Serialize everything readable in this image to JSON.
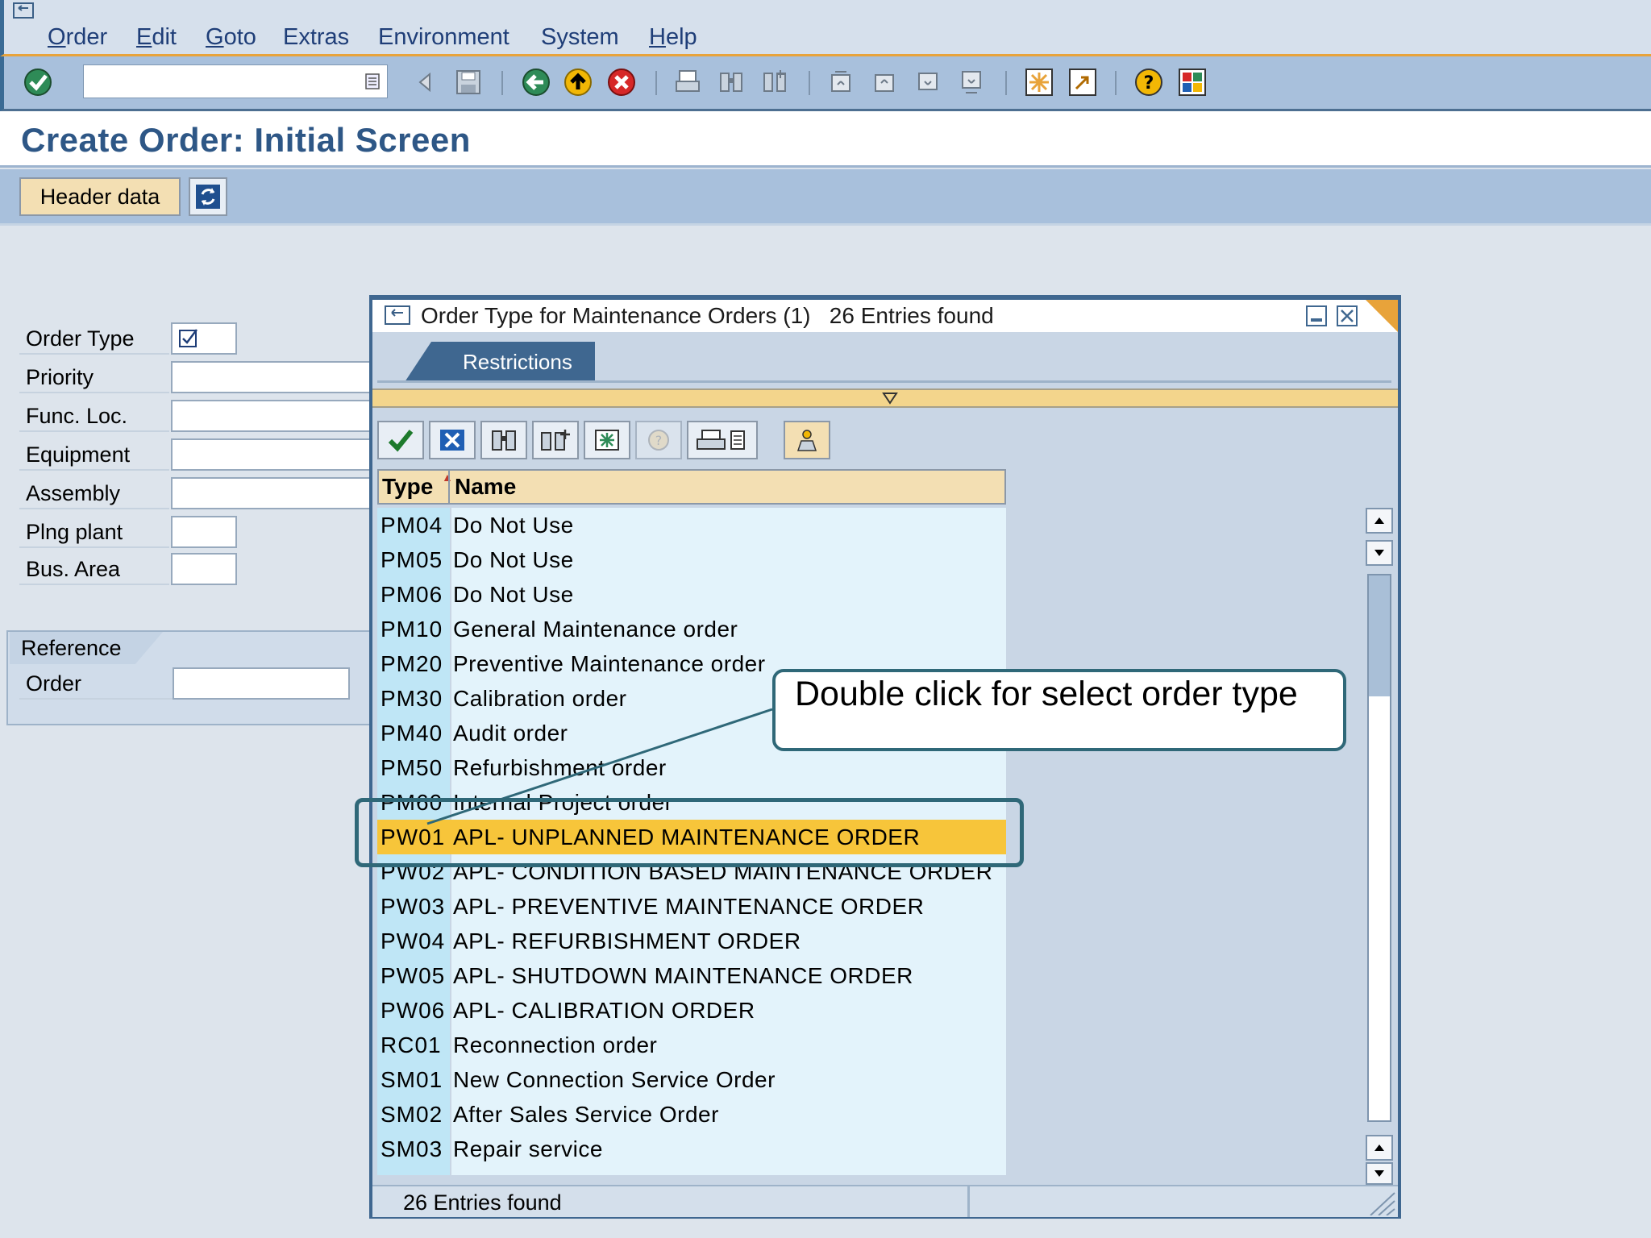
{
  "menu": [
    {
      "label": "Order",
      "u": "O",
      "rest": "rder"
    },
    {
      "label": "Edit",
      "u": "E",
      "rest": "dit"
    },
    {
      "label": "Goto",
      "u": "G",
      "rest": "oto"
    },
    {
      "label": "Extras",
      "u": "",
      "rest": "Extras"
    },
    {
      "label": "Environment",
      "u": "",
      "rest": "Environment"
    },
    {
      "label": "System",
      "u": "",
      "rest": "System"
    },
    {
      "label": "Help",
      "u": "H",
      "rest": "elp"
    }
  ],
  "page": {
    "title": "Create Order: Initial Screen"
  },
  "app_toolbar": {
    "header_data": "Header data"
  },
  "form": {
    "order_type": "Order Type",
    "priority": "Priority",
    "func_loc": "Func. Loc.",
    "equipment": "Equipment",
    "assembly": "Assembly",
    "plng_plant": "Plng plant",
    "bus_area": "Bus. Area",
    "reference_group": "Reference",
    "reference_order": "Order"
  },
  "dialog": {
    "title": "Order Type for Maintenance Orders (1)   26 Entries found",
    "tab_restrictions": "Restrictions",
    "col_type": "Type",
    "col_name": "Name",
    "rows": [
      {
        "type": "PM04",
        "name": "Do Not Use"
      },
      {
        "type": "PM05",
        "name": "Do Not Use"
      },
      {
        "type": "PM06",
        "name": "Do Not Use"
      },
      {
        "type": "PM10",
        "name": "General Maintenance order"
      },
      {
        "type": "PM20",
        "name": "Preventive Maintenance order"
      },
      {
        "type": "PM30",
        "name": "Calibration order"
      },
      {
        "type": "PM40",
        "name": "Audit order"
      },
      {
        "type": "PM50",
        "name": "Refurbishment order"
      },
      {
        "type": "PM60",
        "name": "Internal Project order"
      },
      {
        "type": "PW01",
        "name": "APL- UNPLANNED MAINTENANCE ORDER",
        "selected": true
      },
      {
        "type": "PW02",
        "name": "APL- CONDITION BASED MAINTENANCE ORDER"
      },
      {
        "type": "PW03",
        "name": "APL- PREVENTIVE MAINTENANCE ORDER"
      },
      {
        "type": "PW04",
        "name": "APL- REFURBISHMENT ORDER"
      },
      {
        "type": "PW05",
        "name": "APL- SHUTDOWN MAINTENANCE ORDER"
      },
      {
        "type": "PW06",
        "name": "APL- CALIBRATION ORDER"
      },
      {
        "type": "RC01",
        "name": "Reconnection order"
      },
      {
        "type": "SM01",
        "name": "New Connection Service Order"
      },
      {
        "type": "SM02",
        "name": "After Sales Service Order"
      },
      {
        "type": "SM03",
        "name": "Repair service"
      }
    ],
    "status": "26 Entries found"
  },
  "annotation": {
    "callout": "Double click for select order type"
  },
  "colors": {
    "accent_orange": "#e8a33a",
    "title_blue": "#2e5786",
    "selected_row": "#f7c53a",
    "callout_border": "#2f6878"
  }
}
